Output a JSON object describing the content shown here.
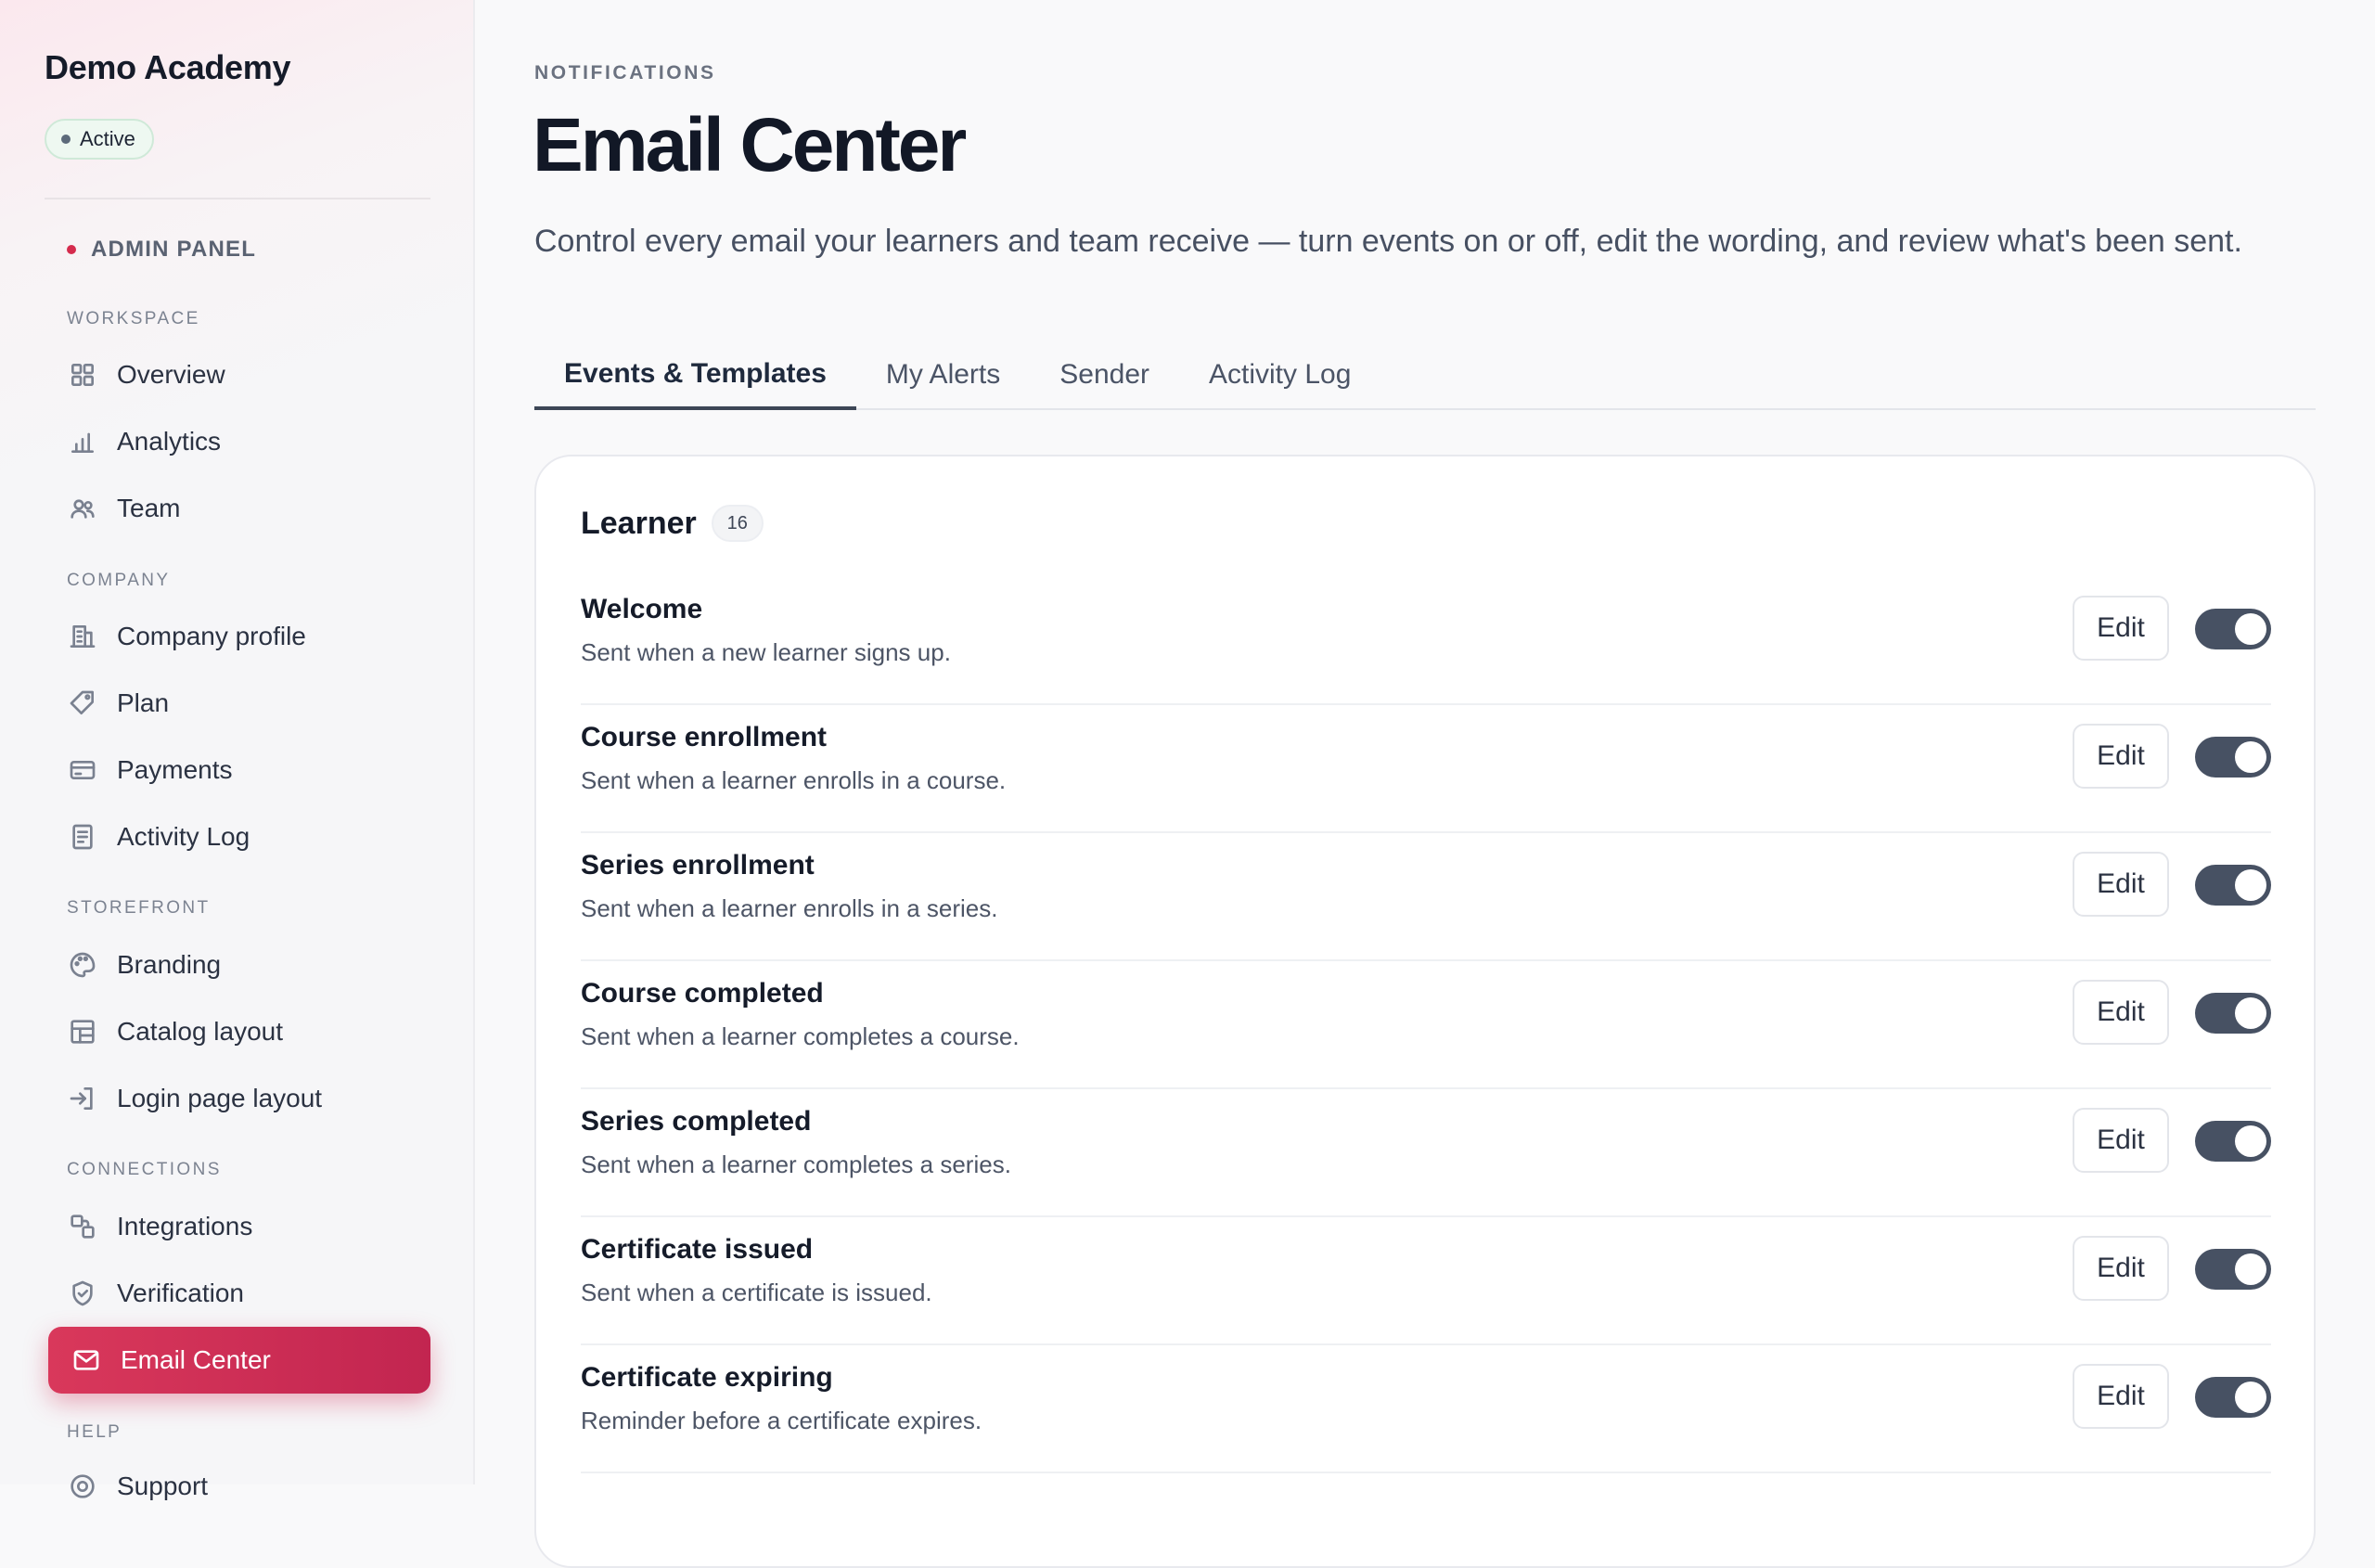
{
  "sidebar": {
    "brand": "Demo Academy",
    "status": "Active",
    "panel_label": "ADMIN PANEL",
    "sections": [
      {
        "label": "WORKSPACE"
      },
      {
        "label": "COMPANY"
      },
      {
        "label": "STOREFRONT"
      },
      {
        "label": "CONNECTIONS"
      },
      {
        "label": "HELP"
      }
    ],
    "items": [
      {
        "label": "Overview",
        "icon": "grid-icon"
      },
      {
        "label": "Analytics",
        "icon": "bar-chart-icon"
      },
      {
        "label": "Team",
        "icon": "users-icon"
      },
      {
        "label": "Company profile",
        "icon": "building-icon"
      },
      {
        "label": "Plan",
        "icon": "tag-icon"
      },
      {
        "label": "Payments",
        "icon": "credit-card-icon"
      },
      {
        "label": "Activity Log",
        "icon": "document-icon"
      },
      {
        "label": "Branding",
        "icon": "palette-icon"
      },
      {
        "label": "Catalog layout",
        "icon": "layout-icon"
      },
      {
        "label": "Login page layout",
        "icon": "login-icon"
      },
      {
        "label": "Integrations",
        "icon": "integrations-icon"
      },
      {
        "label": "Verification",
        "icon": "shield-check-icon"
      },
      {
        "label": "Email Center",
        "icon": "mail-icon",
        "active": true
      },
      {
        "label": "Support",
        "icon": "support-icon"
      }
    ]
  },
  "header": {
    "eyebrow": "NOTIFICATIONS",
    "title": "Email Center",
    "description": "Control every email your learners and team receive — turn events on or off, edit the wording, and review what's been sent."
  },
  "tabs": [
    {
      "label": "Events & Templates",
      "active": true
    },
    {
      "label": "My Alerts"
    },
    {
      "label": "Sender"
    },
    {
      "label": "Activity Log"
    }
  ],
  "card": {
    "title": "Learner",
    "count": "16",
    "edit_label": "Edit",
    "events": [
      {
        "title": "Welcome",
        "description": "Sent when a new learner signs up.",
        "enabled": true
      },
      {
        "title": "Course enrollment",
        "description": "Sent when a learner enrolls in a course.",
        "enabled": true
      },
      {
        "title": "Series enrollment",
        "description": "Sent when a learner enrolls in a series.",
        "enabled": true
      },
      {
        "title": "Course completed",
        "description": "Sent when a learner completes a course.",
        "enabled": true
      },
      {
        "title": "Series completed",
        "description": "Sent when a learner completes a series.",
        "enabled": true
      },
      {
        "title": "Certificate issued",
        "description": "Sent when a certificate is issued.",
        "enabled": true
      },
      {
        "title": "Certificate expiring",
        "description": "Reminder before a certificate expires.",
        "enabled": true
      }
    ]
  },
  "colors": {
    "accent": "#d0305a",
    "toggle_on": "#475163",
    "status_bg": "#eef8f1"
  }
}
